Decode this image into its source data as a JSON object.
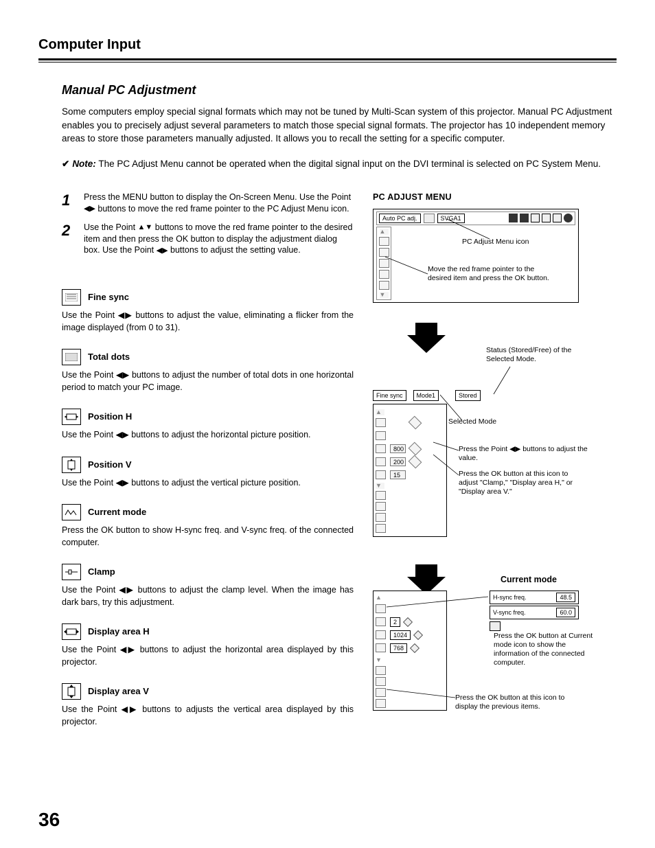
{
  "header": {
    "title": "Computer Input"
  },
  "h2": "Manual PC Adjustment",
  "intro": "Some computers employ special signal formats which may not be tuned by Multi-Scan system of this projector. Manual PC Adjustment enables you to precisely adjust several parameters to match those special signal formats. The projector has 10 independent memory areas to store those parameters manually adjusted. It allows you to recall the setting for a specific computer.",
  "note": {
    "check": "✔",
    "label": "Note:",
    "body": "The PC Adjust Menu cannot be operated when the digital signal input on the DVI terminal is selected on PC System Menu."
  },
  "steps": [
    {
      "num": "1",
      "text_a": "Press the MENU button to display the On-Screen Menu. Use the Point ",
      "text_b": " buttons to move the red frame pointer to the PC Adjust Menu icon."
    },
    {
      "num": "2",
      "text_a": "Use the Point ",
      "text_mid": " buttons to move the red frame pointer to the desired item and then press the OK button to display the adjustment dialog box. Use the Point ",
      "text_b": " buttons to adjust the setting value."
    }
  ],
  "items": [
    {
      "title": "Fine sync",
      "body": "Use the Point ◀▶ buttons to adjust the value, eliminating a flicker from the image displayed (from 0 to 31)."
    },
    {
      "title": "Total dots",
      "body": "Use the Point ◀▶ buttons to adjust the number of total dots in one horizontal period to match your PC image."
    },
    {
      "title": "Position H",
      "body": "Use the Point ◀▶ buttons to adjust the horizontal picture position."
    },
    {
      "title": "Position V",
      "body": "Use the Point ◀▶ buttons to adjust the vertical picture position."
    },
    {
      "title": "Current mode",
      "body": "Press the OK button to show H-sync freq. and V-sync freq. of  the connected computer."
    },
    {
      "title": "Clamp",
      "body": "Use the Point ◀▶ buttons to adjust the clamp level. When the image has dark bars, try this adjustment."
    },
    {
      "title": "Display area H",
      "body": "Use the Point ◀▶ buttons to adjust the horizontal area displayed by this projector."
    },
    {
      "title": "Display area V",
      "body": "Use the Point ◀▶ buttons to adjusts the vertical area displayed by this projector."
    }
  ],
  "right": {
    "heading": "PC ADJUST MENU",
    "menu": {
      "auto": "Auto PC adj.",
      "mode": "SVGA1"
    },
    "ann": {
      "icon": "PC Adjust Menu icon",
      "move": "Move the red frame pointer to the desired item and press the OK button.",
      "status": "Status (Stored/Free) of the Selected Mode.",
      "selmode": "Selected Mode",
      "pressadj": "Press the Point ◀▶ buttons to adjust the value.",
      "pressok": "Press the OK button at this icon to adjust \"Clamp,\" \"Display area H,\" or \"Display area V.\"",
      "cm_title": "Current mode",
      "cm_info": "Press the OK button at Current mode icon to show the information of the connected computer.",
      "prev": "Press the OK button at this icon to display the previous items."
    },
    "panel2": {
      "l1": "Fine sync",
      "l2": "Mode1",
      "l3": "Stored",
      "v1": "800",
      "v2": "200",
      "v3": "15"
    },
    "panel3": {
      "h": "H-sync freq.",
      "hv": "48.5",
      "v": "V-sync freq.",
      "vv": "60.0",
      "a": "2",
      "b": "1024",
      "c": "768"
    }
  },
  "page": "36"
}
